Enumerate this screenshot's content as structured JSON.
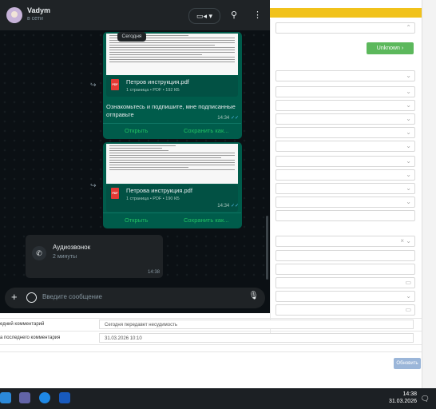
{
  "whatsapp": {
    "contact_name": "Vadym",
    "contact_status": "в сети",
    "date_chip": "Сегодня",
    "messages": [
      {
        "file_name": "Петров инструкция.pdf",
        "file_meta": "1 страница • PDF • 192 КБ",
        "text": "Ознакомьтесь и подпишите, мне подписанные отправьте",
        "time": "14:34",
        "open_label": "Открыть",
        "save_label": "Сохранить как..."
      },
      {
        "file_name": "Петрова инструкция.pdf",
        "file_meta": "1 страница • PDF • 190 КБ",
        "time": "14:34",
        "open_label": "Открыть",
        "save_label": "Сохранить как..."
      }
    ],
    "call": {
      "title": "Аудиозвонок",
      "duration": "2 минуты",
      "time": "14:38"
    },
    "composer_placeholder": "Введите сообщение",
    "icons": [
      "video-icon",
      "search-icon",
      "menu-dots-icon",
      "plus-icon",
      "emoji-icon",
      "mic-icon",
      "forward-icon",
      "phone-icon",
      "pdf-icon",
      "double-check-icon"
    ]
  },
  "crm": {
    "status_button": "Unknown",
    "rows": [
      {
        "label": "едний комментарий",
        "value": "Сегодня передавет несудимость"
      },
      {
        "label": "а последнего комментария",
        "value": "31.03.2026 10:10"
      }
    ],
    "update_button": "Обновить"
  },
  "taskbar": {
    "time": "14:38",
    "date": "31.03.2026"
  },
  "colors": {
    "wa_bubble": "#005c4b",
    "wa_accent": "#21c063",
    "crm_yellow": "#f1c21b",
    "crm_green": "#5cb85c"
  }
}
